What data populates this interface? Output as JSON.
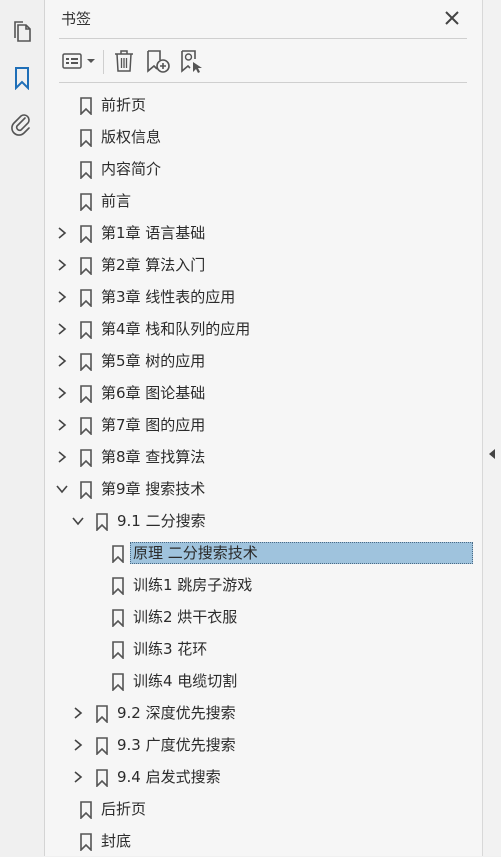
{
  "panel": {
    "title": "书签"
  },
  "toolbar": {
    "options_icon": "bookmark-options-icon",
    "delete_icon": "trash-icon",
    "add_icon": "new-bookmark-icon",
    "find_icon": "find-bookmark-icon"
  },
  "colors": {
    "selection_bg": "#9fc3dd",
    "rail_active": "#1f6fb8"
  },
  "bookmarks": [
    {
      "label": "前折页",
      "level": 0,
      "expander": "none"
    },
    {
      "label": "版权信息",
      "level": 0,
      "expander": "none"
    },
    {
      "label": "内容简介",
      "level": 0,
      "expander": "none"
    },
    {
      "label": "前言",
      "level": 0,
      "expander": "none"
    },
    {
      "label": "第1章 语言基础",
      "level": 0,
      "expander": "collapsed"
    },
    {
      "label": "第2章 算法入门",
      "level": 0,
      "expander": "collapsed"
    },
    {
      "label": "第3章 线性表的应用",
      "level": 0,
      "expander": "collapsed"
    },
    {
      "label": "第4章 栈和队列的应用",
      "level": 0,
      "expander": "collapsed"
    },
    {
      "label": "第5章 树的应用",
      "level": 0,
      "expander": "collapsed"
    },
    {
      "label": "第6章 图论基础",
      "level": 0,
      "expander": "collapsed"
    },
    {
      "label": "第7章 图的应用",
      "level": 0,
      "expander": "collapsed"
    },
    {
      "label": "第8章 查找算法",
      "level": 0,
      "expander": "collapsed"
    },
    {
      "label": "第9章 搜索技术",
      "level": 0,
      "expander": "expanded"
    },
    {
      "label": "9.1 二分搜索",
      "level": 1,
      "expander": "expanded"
    },
    {
      "label": "原理 二分搜索技术",
      "level": 2,
      "expander": "none",
      "selected": true
    },
    {
      "label": "训练1 跳房子游戏",
      "level": 2,
      "expander": "none"
    },
    {
      "label": "训练2 烘干衣服",
      "level": 2,
      "expander": "none"
    },
    {
      "label": "训练3 花环",
      "level": 2,
      "expander": "none"
    },
    {
      "label": "训练4 电缆切割",
      "level": 2,
      "expander": "none"
    },
    {
      "label": "9.2 深度优先搜索",
      "level": 1,
      "expander": "collapsed"
    },
    {
      "label": "9.3 广度优先搜索",
      "level": 1,
      "expander": "collapsed"
    },
    {
      "label": "9.4 启发式搜索",
      "level": 1,
      "expander": "collapsed"
    },
    {
      "label": "后折页",
      "level": 0,
      "expander": "none"
    },
    {
      "label": "封底",
      "level": 0,
      "expander": "none"
    }
  ]
}
